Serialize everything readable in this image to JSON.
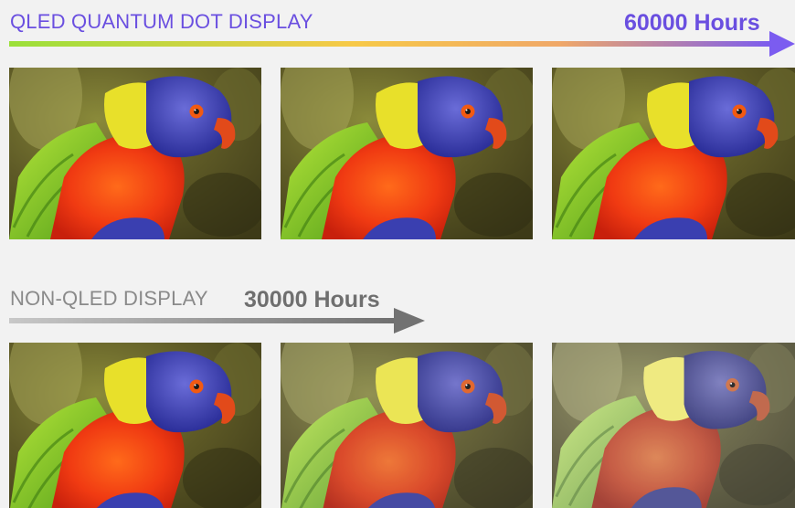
{
  "qled": {
    "title": "QLED QUANTUM DOT DISPLAY",
    "hours": "60000 Hours",
    "colors": [
      "#9be03a",
      "#f7c948",
      "#f0a868",
      "#7b5cf0"
    ],
    "images": [
      {
        "alt": "parrot",
        "saturation": 1.0,
        "fade": 0.0
      },
      {
        "alt": "parrot",
        "saturation": 1.0,
        "fade": 0.0
      },
      {
        "alt": "parrot",
        "saturation": 1.0,
        "fade": 0.0
      }
    ]
  },
  "non_qled": {
    "title": "NON-QLED DISPLAY",
    "hours": "30000 Hours",
    "colors": [
      "#c8c8c8",
      "#6f6f6f"
    ],
    "images": [
      {
        "alt": "parrot",
        "saturation": 1.0,
        "fade": 0.0
      },
      {
        "alt": "parrot",
        "saturation": 0.8,
        "fade": 0.15
      },
      {
        "alt": "parrot",
        "saturation": 0.6,
        "fade": 0.32
      }
    ]
  }
}
